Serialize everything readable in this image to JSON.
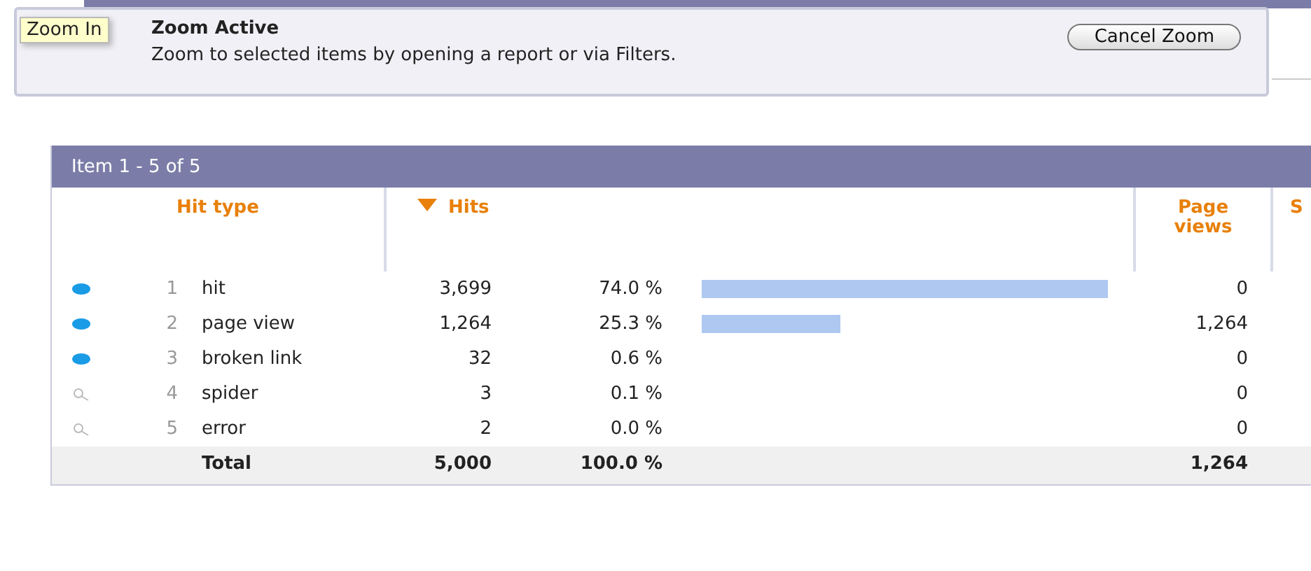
{
  "zoom_panel": {
    "tooltip": "Zoom In",
    "title": "Zoom Active",
    "message": "Zoom to selected items by opening a report or via Filters.",
    "button": "Cancel Zoom"
  },
  "table": {
    "caption": "Item 1 - 5 of 5",
    "columns": [
      {
        "label": "Hit type",
        "sorted": false
      },
      {
        "label": "Hits",
        "sorted": true
      },
      {
        "label": "Page views",
        "sorted": false
      },
      {
        "label": "S",
        "sorted": false
      }
    ],
    "rows": [
      {
        "kind": "dot",
        "index": "1",
        "name": "hit",
        "hits": "3,699",
        "percent": "74.0 %",
        "page_views": "0"
      },
      {
        "kind": "dot",
        "index": "2",
        "name": "page view",
        "hits": "1,264",
        "percent": "25.3 %",
        "page_views": "1,264"
      },
      {
        "kind": "dot",
        "index": "3",
        "name": "broken link",
        "hits": "32",
        "percent": "0.6 %",
        "page_views": "0"
      },
      {
        "kind": "magnifier",
        "index": "4",
        "name": "spider",
        "hits": "3",
        "percent": "0.1 %",
        "page_views": "0"
      },
      {
        "kind": "magnifier",
        "index": "5",
        "name": "error",
        "hits": "2",
        "percent": "0.0 %",
        "page_views": "0"
      }
    ],
    "total": {
      "label": "Total",
      "hits": "5,000",
      "percent": "100.0 %",
      "page_views": "1,264"
    }
  }
}
